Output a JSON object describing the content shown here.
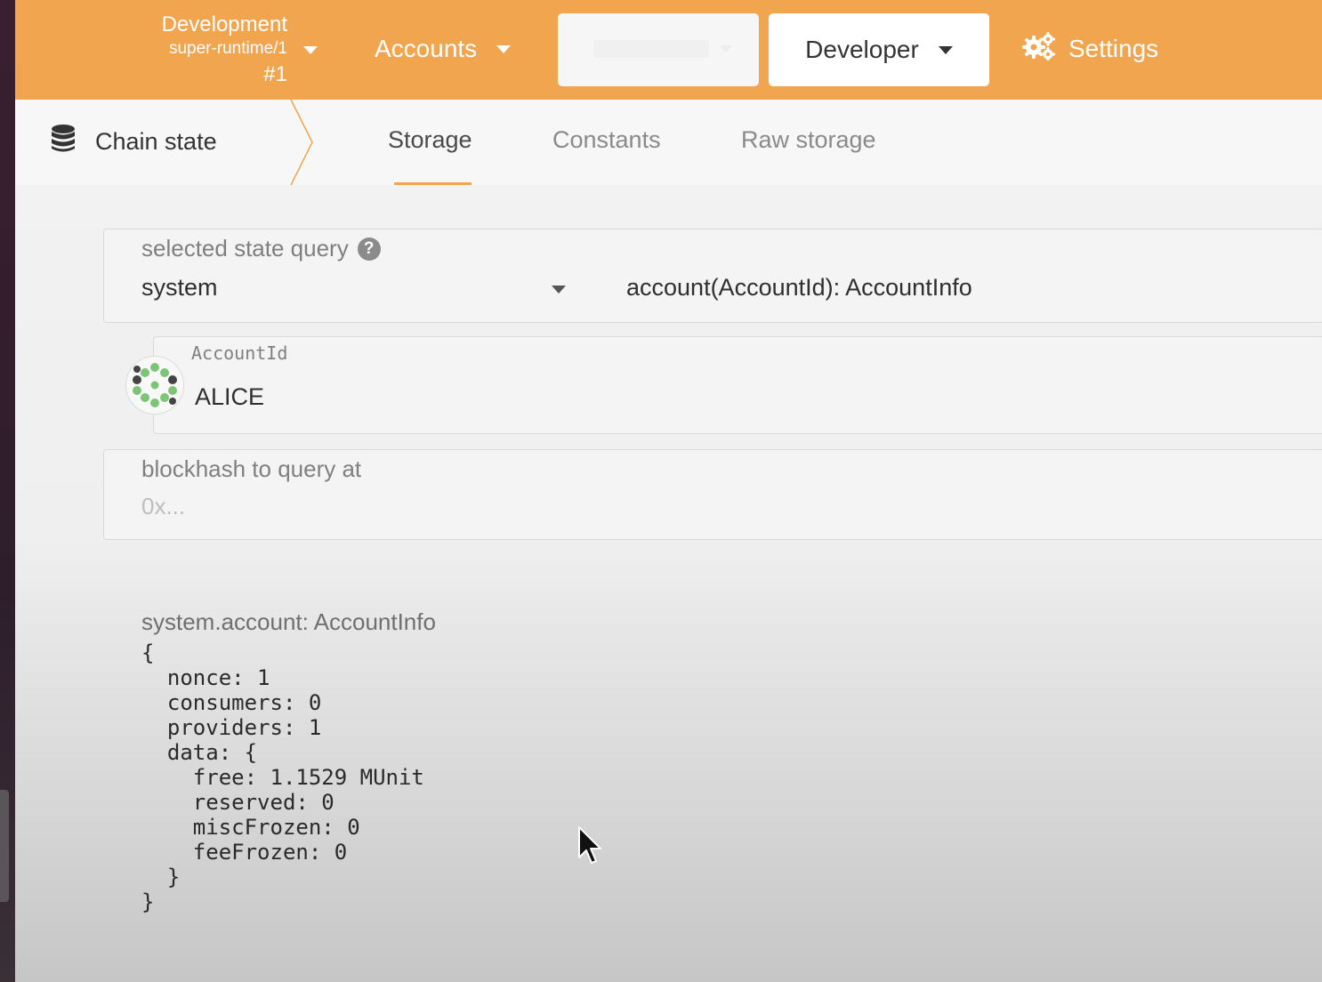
{
  "chain": {
    "name": "Development",
    "runtime": "super-runtime/1",
    "block": "#1"
  },
  "nav": {
    "accounts_label": "Accounts",
    "developer_label": "Developer",
    "settings_label": "Settings"
  },
  "subnav": {
    "section_title": "Chain state",
    "tabs": [
      {
        "label": "Storage",
        "active": true
      },
      {
        "label": "Constants",
        "active": false
      },
      {
        "label": "Raw storage",
        "active": false
      }
    ]
  },
  "query": {
    "label": "selected state query",
    "section_value": "system",
    "method_value": "account(AccountId): AccountInfo"
  },
  "account": {
    "label": "AccountId",
    "value": "ALICE"
  },
  "blockhash": {
    "label": "blockhash to query at",
    "placeholder": "0x..."
  },
  "result": {
    "label": "system.account: AccountInfo",
    "lines": [
      "{",
      "  nonce: 1",
      "  consumers: 0",
      "  providers: 1",
      "  data: {",
      "    free: 1.1529 MUnit",
      "    reserved: 0",
      "    miscFrozen: 0",
      "    feeFrozen: 0",
      "  }",
      "}"
    ]
  },
  "colors": {
    "accent": "#f0a54e",
    "identicon_green": "#7cc576"
  }
}
